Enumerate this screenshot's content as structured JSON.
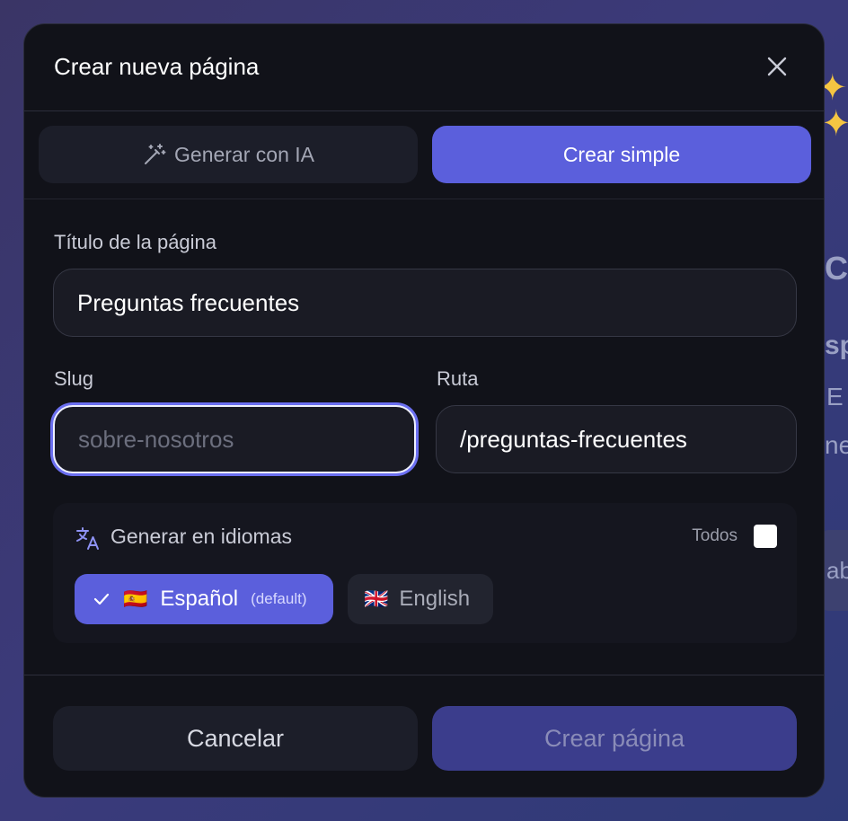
{
  "dialog": {
    "title": "Crear nueva página"
  },
  "tabs": {
    "ai_label": "Generar con IA",
    "simple_label": "Crear simple"
  },
  "form": {
    "title_label": "Título de la página",
    "title_value": "Preguntas frecuentes",
    "slug_label": "Slug",
    "slug_value": "",
    "slug_placeholder": "sobre-nosotros",
    "route_label": "Ruta",
    "route_value": "/preguntas-frecuentes"
  },
  "languages": {
    "title": "Generar en idiomas",
    "all_label": "Todos",
    "all_checked": false,
    "items": [
      {
        "flag": "🇪🇸",
        "label": "Español",
        "note": "(default)",
        "selected": true
      },
      {
        "flag": "🇬🇧",
        "label": "English",
        "note": "",
        "selected": false
      }
    ]
  },
  "footer": {
    "cancel_label": "Cancelar",
    "create_label": "Crear página"
  },
  "background": {
    "fragments": [
      "C",
      "sp",
      "E",
      "ne",
      "ab"
    ]
  },
  "colors": {
    "accent": "#5b5fdc",
    "modal_bg": "#111219",
    "focus_ring": "#6b6ff0",
    "disabled_button": "#3b3d8c"
  }
}
